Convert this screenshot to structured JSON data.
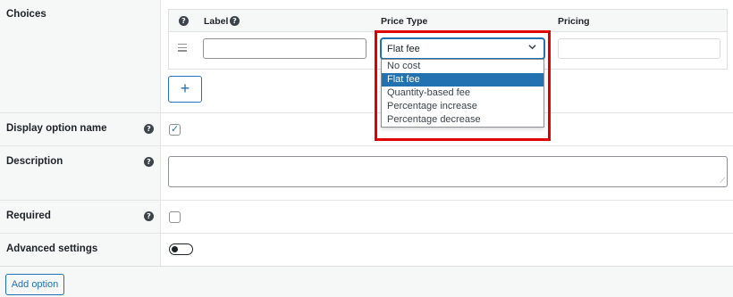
{
  "choices": {
    "label": "Choices",
    "columns": {
      "help_icon": "?",
      "label": "Label",
      "label_help_icon": "?",
      "price_type": "Price Type",
      "pricing": "Pricing"
    },
    "row": {
      "label_value": "",
      "price_type_selected": "Flat fee",
      "pricing_value": ""
    },
    "price_type_options": [
      "No cost",
      "Flat fee",
      "Quantity-based fee",
      "Percentage increase",
      "Percentage decrease"
    ],
    "add_button_label": "+"
  },
  "display_option_name": {
    "label": "Display option name",
    "help_icon": "?",
    "checked": true
  },
  "description": {
    "label": "Description",
    "help_icon": "?",
    "value": ""
  },
  "required": {
    "label": "Required",
    "help_icon": "?",
    "checked": false
  },
  "advanced_settings": {
    "label": "Advanced settings",
    "toggle_on": false
  },
  "footer": {
    "add_option_label": "Add option"
  },
  "colors": {
    "accent": "#2271b1",
    "highlight": "#e00000",
    "label_bg": "#f6f7f7"
  },
  "icons": {
    "drag": "drag-handle-icon",
    "chevron": "chevron-down-icon",
    "help": "help-icon",
    "resize": "resize-grip-icon"
  }
}
